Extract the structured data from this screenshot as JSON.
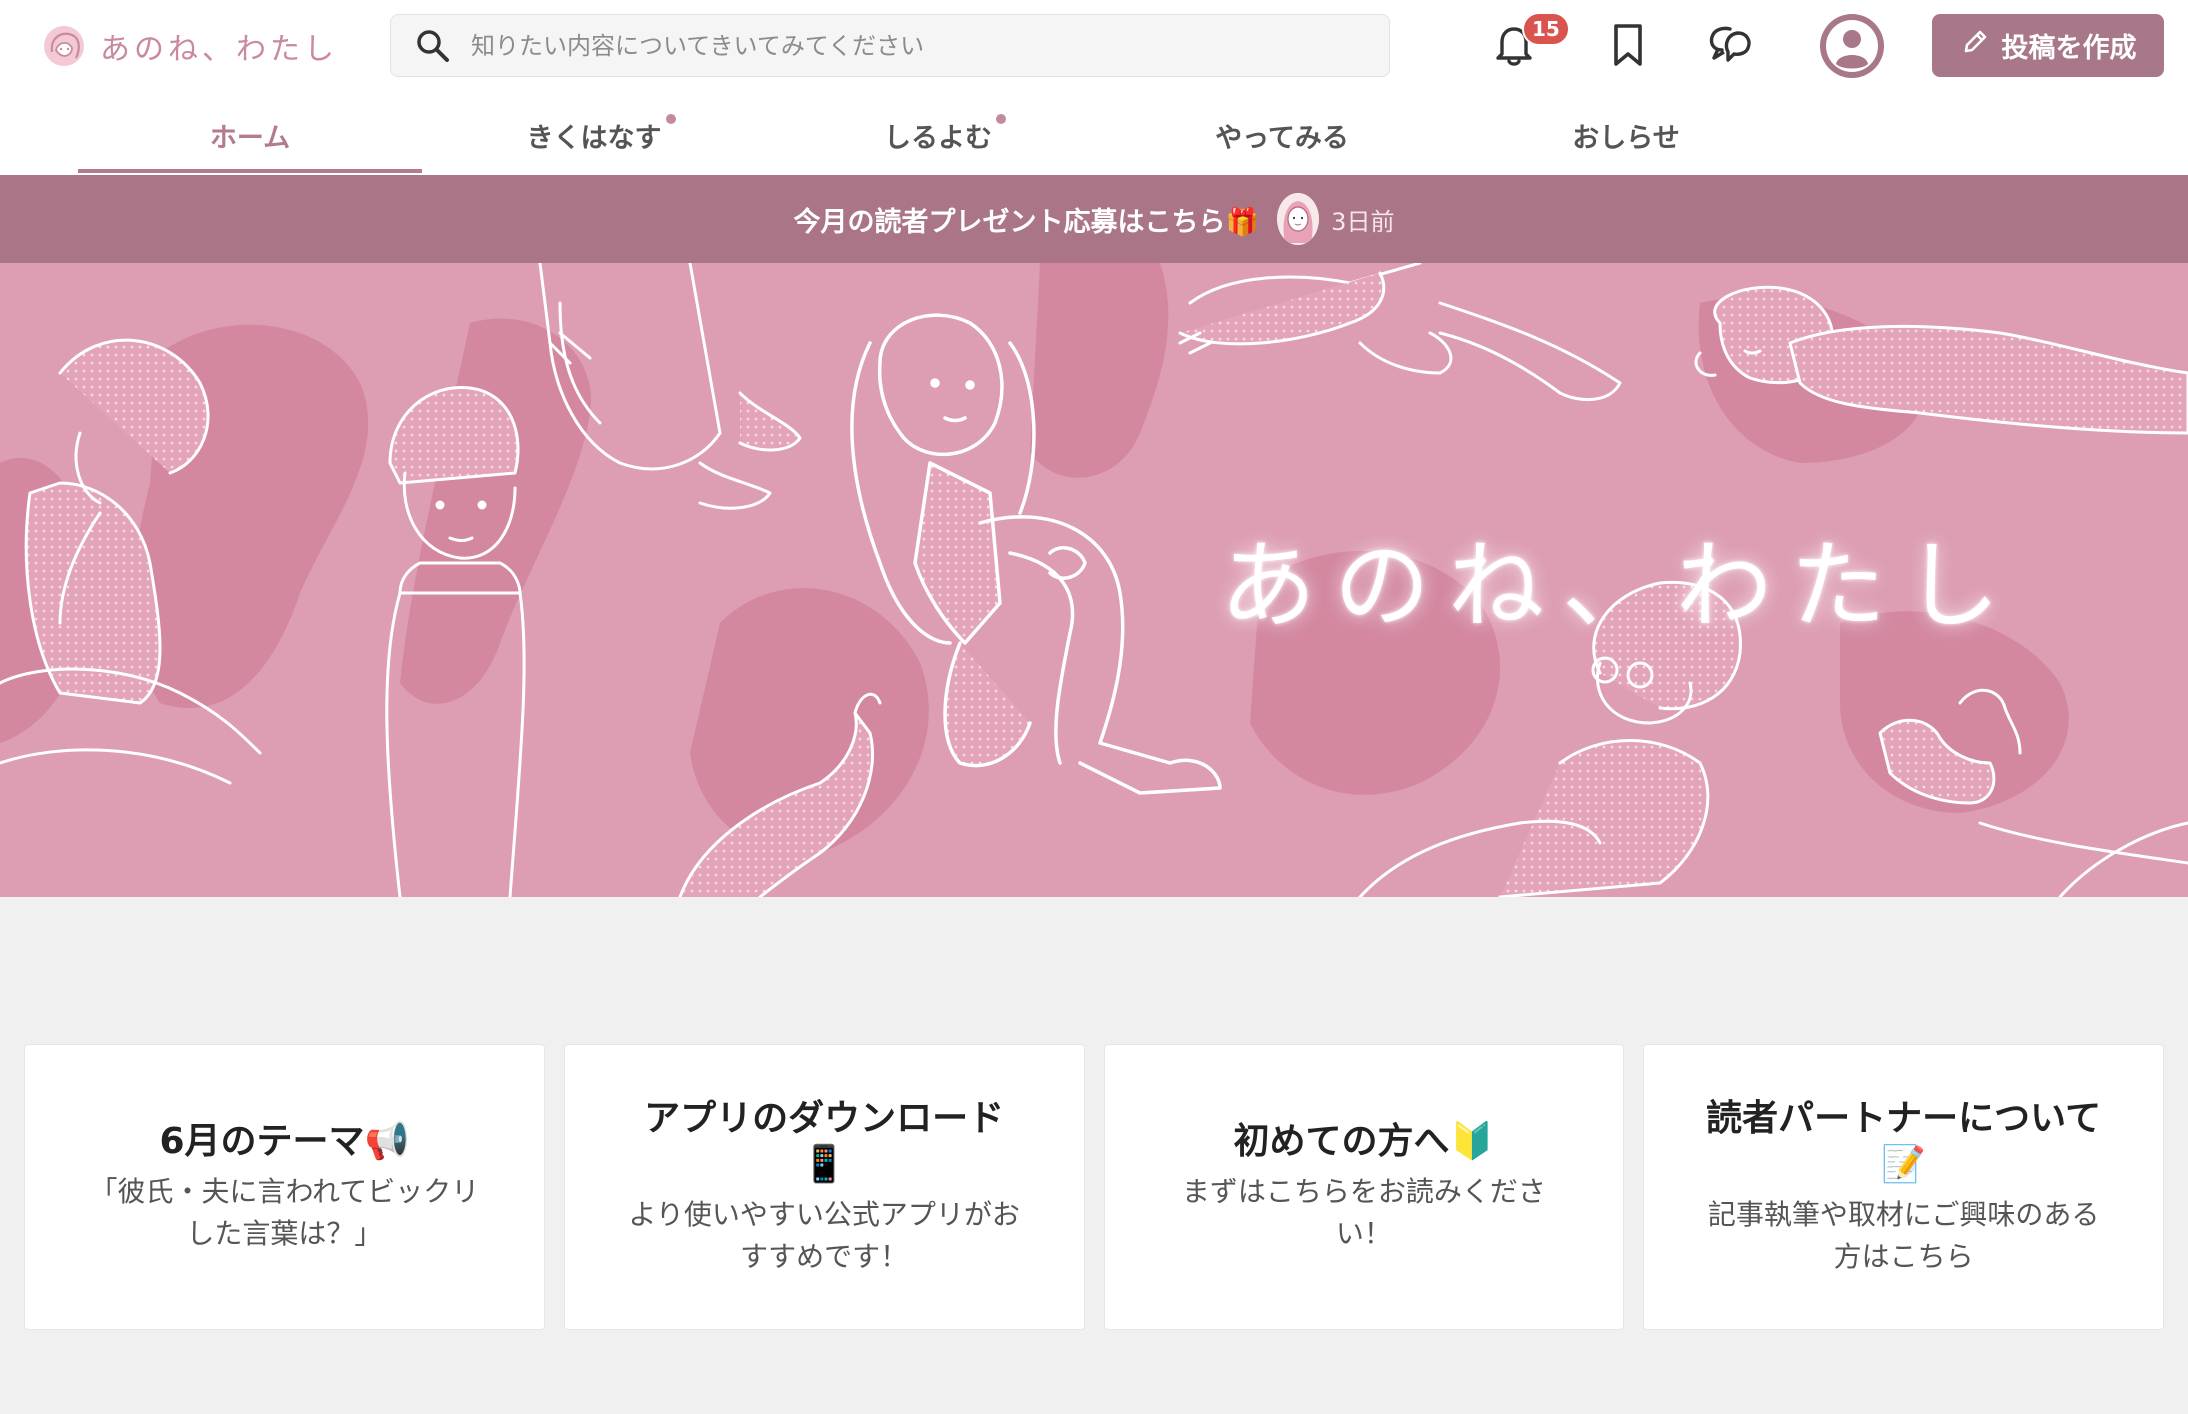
{
  "brand": {
    "name": "あのね、わたし"
  },
  "search": {
    "placeholder": "知りたい内容についてきいてみてください"
  },
  "header": {
    "notifications_count": "15",
    "create_post_label": "投稿を作成"
  },
  "tabs": [
    {
      "label": "ホーム",
      "active": true,
      "has_dot": false
    },
    {
      "label": "きくはなす",
      "active": false,
      "has_dot": true
    },
    {
      "label": "しるよむ",
      "active": false,
      "has_dot": true
    },
    {
      "label": "やってみる",
      "active": false,
      "has_dot": false
    },
    {
      "label": "おしらせ",
      "active": false,
      "has_dot": false
    }
  ],
  "announcement": {
    "text": "今月の読者プレゼント応募はこちら🎁",
    "time": "3日前"
  },
  "hero": {
    "title": "あのね、わたし"
  },
  "cards": [
    {
      "title": "6月のテーマ📢",
      "description": "「彼氏・夫に言われてビックリした言葉は？」"
    },
    {
      "title": "アプリのダウンロード📱",
      "description": "より使いやすい公式アプリがおすすめです！"
    },
    {
      "title": "初めての方へ🔰",
      "description": "まずはこちらをお読みください！"
    },
    {
      "title": "読者パートナーについて📝",
      "description": "記事執筆や取材にご興味のある方はこちら"
    }
  ],
  "colors": {
    "accent": "#a8788a",
    "tab_active": "#b47a8d",
    "announcement_bg": "#aa7587",
    "hero_bg": "#dd9db3",
    "badge": "#d9534f",
    "page_bg": "#f0f0f0"
  },
  "icons": {
    "search": "search-icon",
    "notifications": "bell-icon",
    "bookmarks": "bookmark-icon",
    "messages": "chat-bubbles-icon",
    "profile": "user-avatar-icon",
    "create": "pencil-icon"
  }
}
